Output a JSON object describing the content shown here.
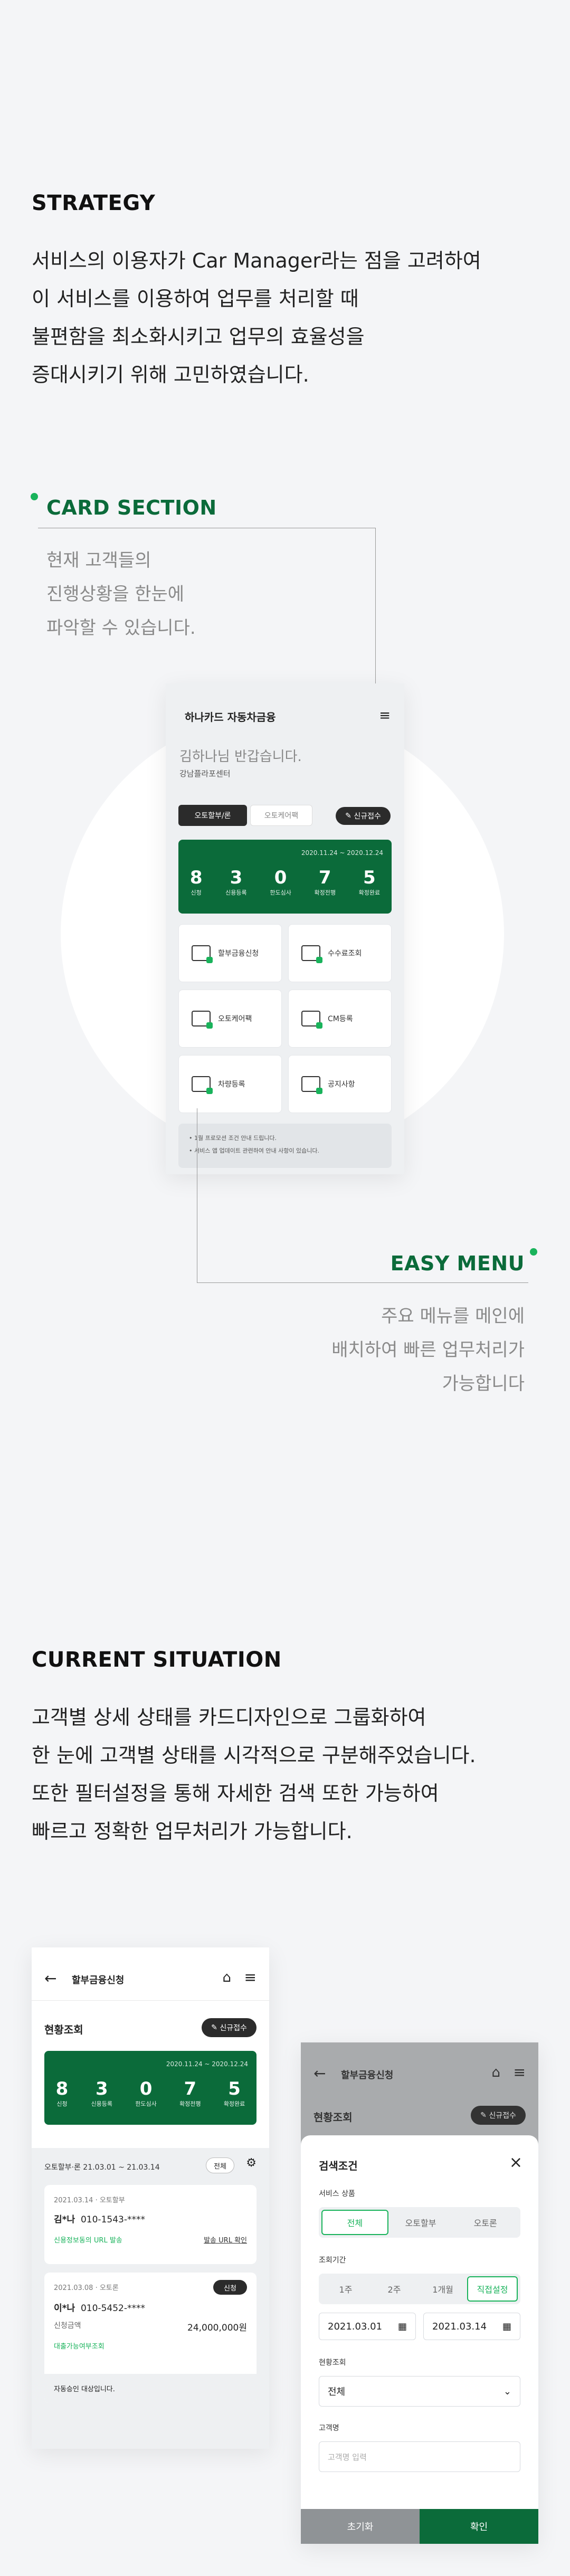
{
  "strategy": {
    "title": "STRATEGY",
    "lines": [
      "서비스의 이용자가 Car Manager라는 점을 고려하여",
      "이 서비스를 이용하여 업무를 처리할 때",
      "불편함을 최소화시키고 업무의 효율성을",
      "증대시키기 위해 고민하였습니다."
    ]
  },
  "card_section": {
    "title": "CARD SECTION",
    "lines": [
      "현재 고객들의",
      "진행상황을 한눈에",
      "파악할 수 있습니다."
    ]
  },
  "easy_menu": {
    "title": "EASY MENU",
    "lines": [
      "주요 메뉴를 메인에",
      "배치하여 빠른 업무처리가",
      "가능합니다"
    ]
  },
  "phone1": {
    "title": "하나카드 자동차금융",
    "greeting": "김하나님 반갑습니다.",
    "branch": "강남플라포센터",
    "tab_active": "오토할부/론",
    "tab_inactive": "오토케어팩",
    "new_button": "신규접수",
    "period": "2020.11.24 ~ 2020.12.24",
    "steps": [
      {
        "num": "8",
        "label": "신청"
      },
      {
        "num": "3",
        "label": "신용등록"
      },
      {
        "num": "0",
        "label": "한도심사"
      },
      {
        "num": "7",
        "label": "확정전행"
      },
      {
        "num": "5",
        "label": "확정완료"
      }
    ],
    "menu": [
      "할부금융신청",
      "수수료조회",
      "오토케어팩",
      "CM등록",
      "차량등록",
      "공지사항"
    ],
    "notices": [
      "1월 프로모션 조건 안내 드립니다.",
      "서비스 앱 업데이트 관련하여 안내 사항이 있습니다."
    ]
  },
  "current": {
    "title": "CURRENT SITUATION",
    "lines": [
      "고객별 상세 상태를 카드디자인으로 그룹화하여",
      "한 눈에 고객별 상태를 시각적으로 구분해주었습니다.",
      "또한 필터설정을 통해 자세한 검색 또한 가능하여",
      "빠르고 정확한 업무처리가 가능합니다."
    ]
  },
  "phone2": {
    "header": "할부금융신청",
    "section": "현황조회",
    "new_button": "신규접수",
    "period": "2020.11.24 ~ 2020.12.24",
    "steps": [
      {
        "num": "8",
        "label": "신청"
      },
      {
        "num": "3",
        "label": "신용등록"
      },
      {
        "num": "0",
        "label": "한도심사"
      },
      {
        "num": "7",
        "label": "확정전행"
      },
      {
        "num": "5",
        "label": "확정완료"
      }
    ],
    "filter_text": "오토할부·론 21.03.01 ~ 21.03.14",
    "filter_chip": "전체",
    "items": [
      {
        "date": "2021.03.14 · 오토할부",
        "name": "김*나",
        "phone": "010-1543-****",
        "link": "신용정보동의 URL 발송",
        "action": "발송 URL 확인"
      },
      {
        "date": "2021.03.08 · 오토론",
        "badge": "신청",
        "name": "이*나",
        "phone": "010-5452-****",
        "amount_label": "신청금액",
        "amount": "24,000,000원",
        "link": "대출가능여부조회"
      }
    ],
    "footer_note": "자동승인 대상입니다."
  },
  "phone3": {
    "header": "할부금융신청",
    "section": "현황조회",
    "new_button": "신규접수",
    "modal_title": "검색조건",
    "service_label": "서비스 상품",
    "service_opts": [
      "전체",
      "오토할부",
      "오토론"
    ],
    "period_label": "조회기간",
    "period_opts": [
      "1주",
      "2주",
      "1개월",
      "직접설정"
    ],
    "date_from": "2021.03.01",
    "date_to": "2021.03.14",
    "status_label": "현황조회",
    "status_value": "전체",
    "customer_label": "고객명",
    "customer_placeholder": "고객명 입력",
    "reset": "초기화",
    "confirm": "확인"
  },
  "colors": {
    "brand_green": "#0b6b3a",
    "accent_green": "#19b35b"
  }
}
